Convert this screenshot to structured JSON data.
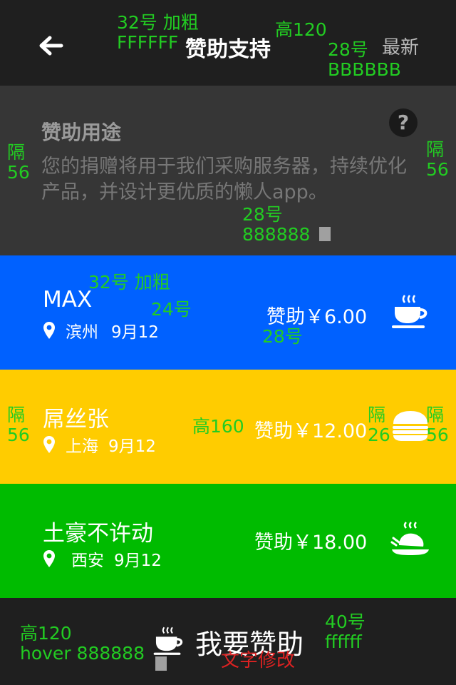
{
  "header": {
    "title": "赞助支持",
    "latest_label": "最新"
  },
  "intro": {
    "title": "赞助用途",
    "help_symbol": "?",
    "description": "您的捐赠将用于我们采购服务器，持续优化产品，并设计更优质的懒人app。"
  },
  "donors": [
    {
      "name": "MAX",
      "city": "滨州",
      "date": "9月12",
      "amount": "赞助￥6.00",
      "icon": "coffee-cup-icon",
      "color": "#0061ff"
    },
    {
      "name": "屌丝张",
      "city": "上海",
      "date": "9月12",
      "amount": "赞助￥12.00",
      "icon": "burger-icon",
      "color": "#ffcc00"
    },
    {
      "name": "土豪不许动",
      "city": "西安",
      "date": "9月12",
      "amount": "赞助￥18.00",
      "icon": "roast-chicken-icon",
      "color": "#00bb00"
    }
  ],
  "donate_button": {
    "label": "我要赞助",
    "icon": "coffee-cup-icon"
  },
  "annotations": {
    "title_spec": [
      "32号  加粗",
      "FFFFFF"
    ],
    "header_height": "高120",
    "latest_spec": [
      "28号",
      "BBBBBB"
    ],
    "side_gap_left": [
      "隔",
      "56"
    ],
    "side_gap_right": [
      "隔",
      "56"
    ],
    "desc_spec": [
      "28号",
      "888888"
    ],
    "name_spec": "32号  加粗",
    "loc_spec": "24号",
    "amount_spec": "28号",
    "row_gap_left": [
      "隔",
      "56"
    ],
    "row_height": "高160",
    "icon_gap": [
      "隔",
      "26"
    ],
    "row_gap_right": [
      "隔",
      "56"
    ],
    "button_spec": [
      "高120",
      "hover 888888"
    ],
    "button_text_spec": [
      "40号",
      "ffffff"
    ],
    "button_text_note": "文字修改"
  },
  "colors": {
    "header_bg": "#1f1f1f",
    "intro_bg": "#363636",
    "annotation_green": "#22cc22",
    "annotation_red": "#dd2222",
    "hover": "#888888"
  }
}
